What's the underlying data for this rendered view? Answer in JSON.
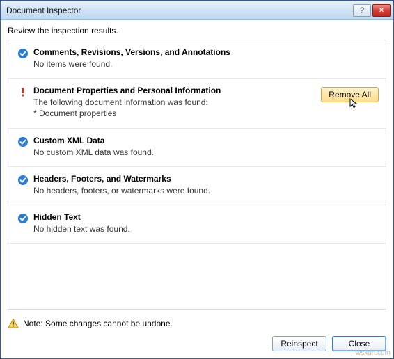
{
  "window": {
    "title": "Document Inspector",
    "help_label": "?",
    "close_label": "×"
  },
  "instruction": "Review the inspection results.",
  "sections": [
    {
      "status": "ok",
      "title": "Comments, Revisions, Versions, and Annotations",
      "body": "No items were found."
    },
    {
      "status": "warn",
      "title": "Document Properties and Personal Information",
      "body": "The following document information was found:",
      "sub": "* Document properties",
      "action": "Remove All"
    },
    {
      "status": "ok",
      "title": "Custom XML Data",
      "body": "No custom XML data was found."
    },
    {
      "status": "ok",
      "title": "Headers, Footers, and Watermarks",
      "body": "No headers, footers, or watermarks were found."
    },
    {
      "status": "ok",
      "title": "Hidden Text",
      "body": "No hidden text was found."
    }
  ],
  "footer": {
    "note": "Note: Some changes cannot be undone.",
    "reinspect": "Reinspect",
    "close": "Close"
  },
  "watermark": "wsxdn.com"
}
